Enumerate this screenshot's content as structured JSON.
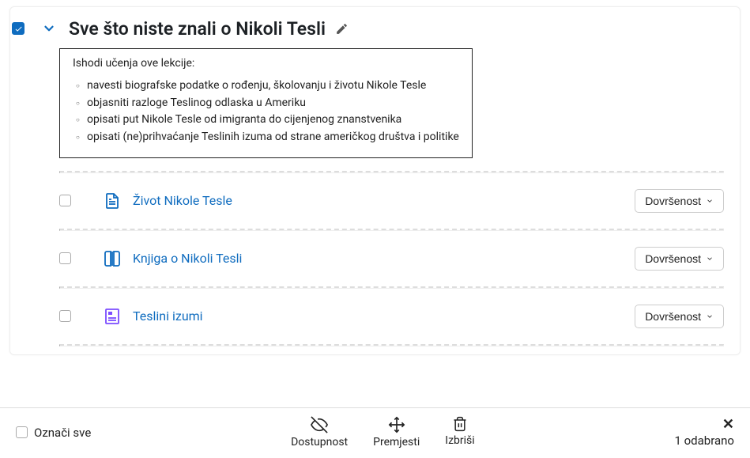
{
  "section": {
    "title": "Sve što niste znali o Nikoli Tesli",
    "checked": true
  },
  "outcomes": {
    "heading": "Ishodi učenja ove lekcije:",
    "items": [
      "navesti biografske podatke o rođenju, školovanju i životu Nikole Tesle",
      "objasniti razloge Teslinog odlaska u Ameriku",
      "opisati put Nikole Tesle od imigranta do cijenjenog znanstvenika",
      "opisati (ne)prihvaćanje Teslinih izuma od strane američkog društva i politike"
    ]
  },
  "items": [
    {
      "label": "Život Nikole Tesle",
      "completion": "Dovršenost",
      "icon": "page"
    },
    {
      "label": "Knjiga o Nikoli Tesli",
      "completion": "Dovršenost",
      "icon": "book"
    },
    {
      "label": "Teslini izumi",
      "completion": "Dovršenost",
      "icon": "glossary"
    }
  ],
  "toolbar": {
    "select_all": "Označi sve",
    "availability": "Dostupnost",
    "move": "Premjesti",
    "delete": "Izbriši",
    "selected": "1 odabrano"
  }
}
